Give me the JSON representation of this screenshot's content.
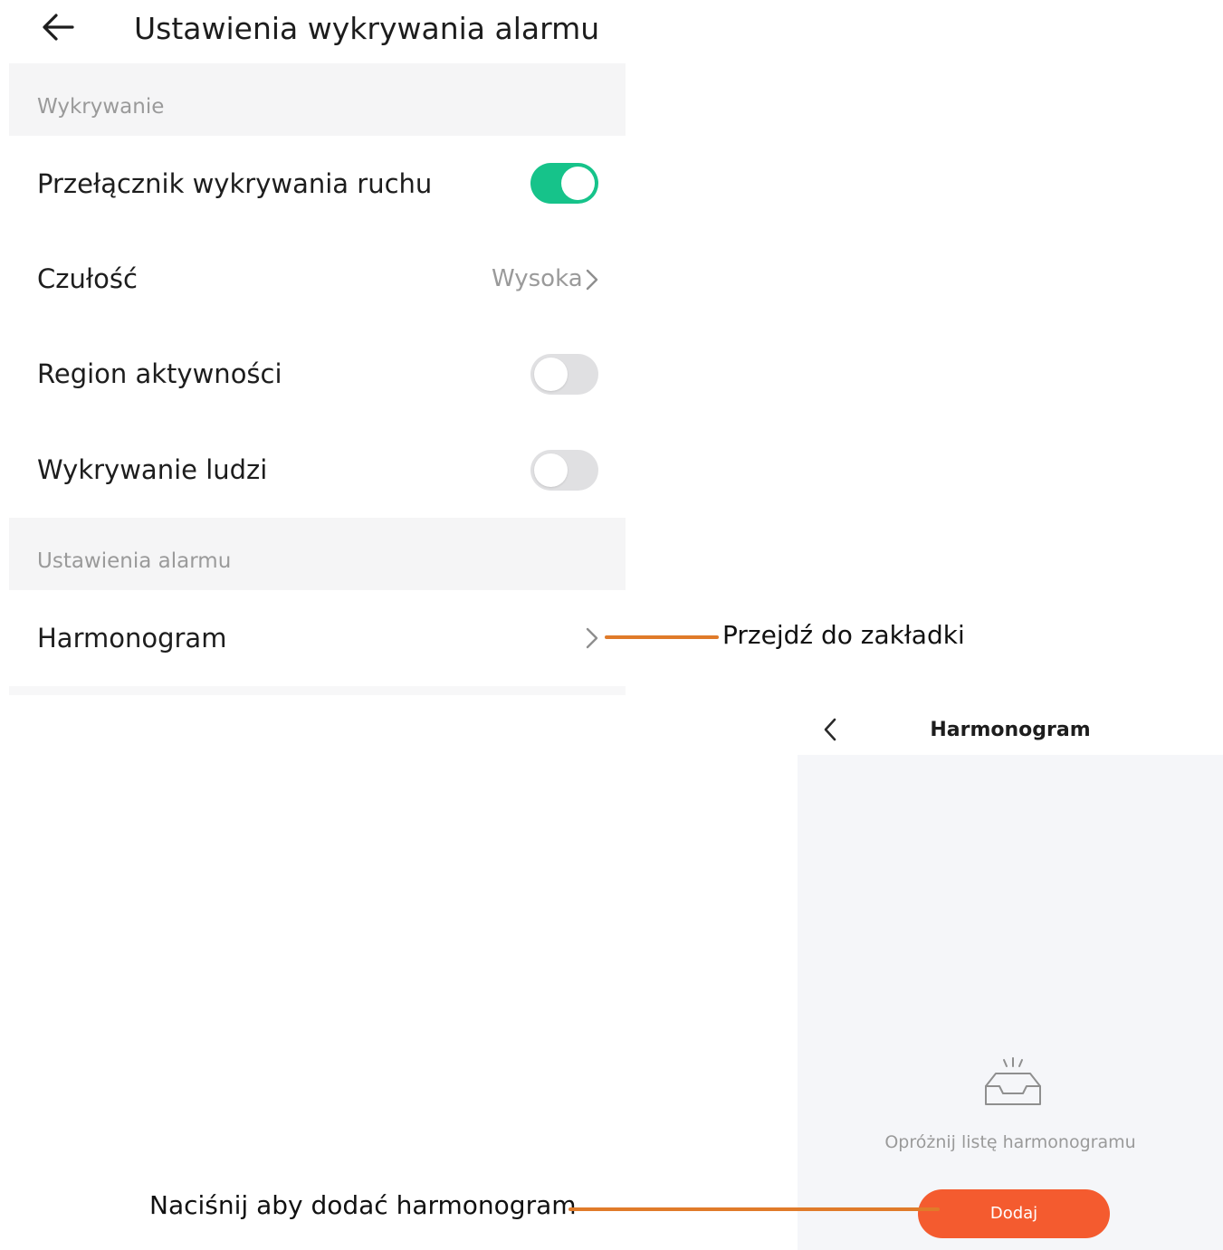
{
  "settings_screen": {
    "title": "Ustawienia wykrywania alarmu",
    "sections": {
      "detection": "Wykrywanie",
      "alarm": "Ustawienia alarmu"
    },
    "rows": {
      "motion_switch": {
        "label": "Przełącznik wykrywania ruchu",
        "enabled": true
      },
      "sensitivity": {
        "label": "Czułość",
        "value": "Wysoka"
      },
      "activity_region": {
        "label": "Region aktywności",
        "enabled": false
      },
      "human_detection": {
        "label": "Wykrywanie ludzi",
        "enabled": false
      },
      "schedule": {
        "label": "Harmonogram"
      }
    }
  },
  "schedule_screen": {
    "title": "Harmonogram",
    "empty_text": "Opróżnij listę harmonogramu",
    "add_label": "Dodaj"
  },
  "annotations": {
    "go_to_tab": "Przejdź do zakładki",
    "press_to_add": "Naciśnij aby dodać harmonogram"
  },
  "colors": {
    "toggle_on": "#16c38a",
    "toggle_off": "#e0e0e2",
    "add_button": "#f45b2f",
    "callout_line": "#e07b2a"
  },
  "icons": [
    "back-arrow-icon",
    "chevron-right-icon",
    "chevron-left-icon",
    "empty-inbox-icon"
  ]
}
